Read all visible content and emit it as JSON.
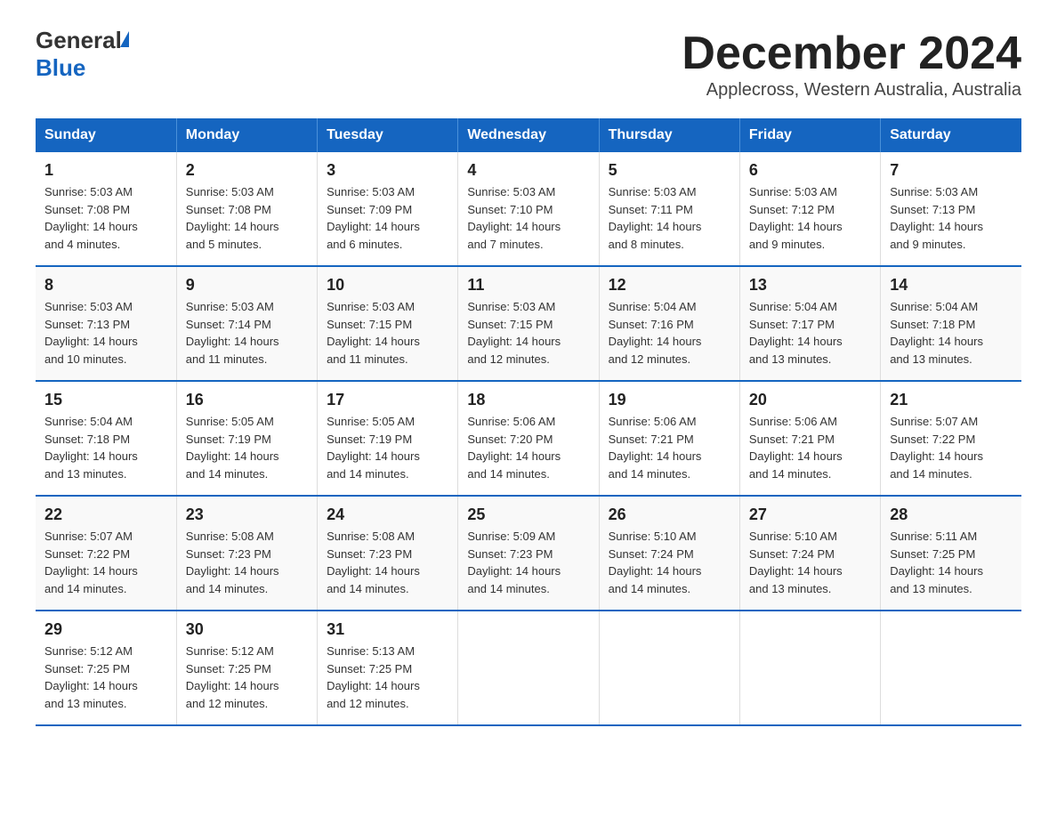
{
  "logo": {
    "general": "General",
    "blue": "Blue"
  },
  "title": "December 2024",
  "location": "Applecross, Western Australia, Australia",
  "days_of_week": [
    "Sunday",
    "Monday",
    "Tuesday",
    "Wednesday",
    "Thursday",
    "Friday",
    "Saturday"
  ],
  "weeks": [
    [
      {
        "day": 1,
        "sunrise": "5:03 AM",
        "sunset": "7:08 PM",
        "daylight": "14 hours and 4 minutes."
      },
      {
        "day": 2,
        "sunrise": "5:03 AM",
        "sunset": "7:08 PM",
        "daylight": "14 hours and 5 minutes."
      },
      {
        "day": 3,
        "sunrise": "5:03 AM",
        "sunset": "7:09 PM",
        "daylight": "14 hours and 6 minutes."
      },
      {
        "day": 4,
        "sunrise": "5:03 AM",
        "sunset": "7:10 PM",
        "daylight": "14 hours and 7 minutes."
      },
      {
        "day": 5,
        "sunrise": "5:03 AM",
        "sunset": "7:11 PM",
        "daylight": "14 hours and 8 minutes."
      },
      {
        "day": 6,
        "sunrise": "5:03 AM",
        "sunset": "7:12 PM",
        "daylight": "14 hours and 9 minutes."
      },
      {
        "day": 7,
        "sunrise": "5:03 AM",
        "sunset": "7:13 PM",
        "daylight": "14 hours and 9 minutes."
      }
    ],
    [
      {
        "day": 8,
        "sunrise": "5:03 AM",
        "sunset": "7:13 PM",
        "daylight": "14 hours and 10 minutes."
      },
      {
        "day": 9,
        "sunrise": "5:03 AM",
        "sunset": "7:14 PM",
        "daylight": "14 hours and 11 minutes."
      },
      {
        "day": 10,
        "sunrise": "5:03 AM",
        "sunset": "7:15 PM",
        "daylight": "14 hours and 11 minutes."
      },
      {
        "day": 11,
        "sunrise": "5:03 AM",
        "sunset": "7:15 PM",
        "daylight": "14 hours and 12 minutes."
      },
      {
        "day": 12,
        "sunrise": "5:04 AM",
        "sunset": "7:16 PM",
        "daylight": "14 hours and 12 minutes."
      },
      {
        "day": 13,
        "sunrise": "5:04 AM",
        "sunset": "7:17 PM",
        "daylight": "14 hours and 13 minutes."
      },
      {
        "day": 14,
        "sunrise": "5:04 AM",
        "sunset": "7:18 PM",
        "daylight": "14 hours and 13 minutes."
      }
    ],
    [
      {
        "day": 15,
        "sunrise": "5:04 AM",
        "sunset": "7:18 PM",
        "daylight": "14 hours and 13 minutes."
      },
      {
        "day": 16,
        "sunrise": "5:05 AM",
        "sunset": "7:19 PM",
        "daylight": "14 hours and 14 minutes."
      },
      {
        "day": 17,
        "sunrise": "5:05 AM",
        "sunset": "7:19 PM",
        "daylight": "14 hours and 14 minutes."
      },
      {
        "day": 18,
        "sunrise": "5:06 AM",
        "sunset": "7:20 PM",
        "daylight": "14 hours and 14 minutes."
      },
      {
        "day": 19,
        "sunrise": "5:06 AM",
        "sunset": "7:21 PM",
        "daylight": "14 hours and 14 minutes."
      },
      {
        "day": 20,
        "sunrise": "5:06 AM",
        "sunset": "7:21 PM",
        "daylight": "14 hours and 14 minutes."
      },
      {
        "day": 21,
        "sunrise": "5:07 AM",
        "sunset": "7:22 PM",
        "daylight": "14 hours and 14 minutes."
      }
    ],
    [
      {
        "day": 22,
        "sunrise": "5:07 AM",
        "sunset": "7:22 PM",
        "daylight": "14 hours and 14 minutes."
      },
      {
        "day": 23,
        "sunrise": "5:08 AM",
        "sunset": "7:23 PM",
        "daylight": "14 hours and 14 minutes."
      },
      {
        "day": 24,
        "sunrise": "5:08 AM",
        "sunset": "7:23 PM",
        "daylight": "14 hours and 14 minutes."
      },
      {
        "day": 25,
        "sunrise": "5:09 AM",
        "sunset": "7:23 PM",
        "daylight": "14 hours and 14 minutes."
      },
      {
        "day": 26,
        "sunrise": "5:10 AM",
        "sunset": "7:24 PM",
        "daylight": "14 hours and 14 minutes."
      },
      {
        "day": 27,
        "sunrise": "5:10 AM",
        "sunset": "7:24 PM",
        "daylight": "14 hours and 13 minutes."
      },
      {
        "day": 28,
        "sunrise": "5:11 AM",
        "sunset": "7:25 PM",
        "daylight": "14 hours and 13 minutes."
      }
    ],
    [
      {
        "day": 29,
        "sunrise": "5:12 AM",
        "sunset": "7:25 PM",
        "daylight": "14 hours and 13 minutes."
      },
      {
        "day": 30,
        "sunrise": "5:12 AM",
        "sunset": "7:25 PM",
        "daylight": "14 hours and 12 minutes."
      },
      {
        "day": 31,
        "sunrise": "5:13 AM",
        "sunset": "7:25 PM",
        "daylight": "14 hours and 12 minutes."
      },
      null,
      null,
      null,
      null
    ]
  ],
  "labels": {
    "sunrise": "Sunrise:",
    "sunset": "Sunset:",
    "daylight": "Daylight:"
  }
}
